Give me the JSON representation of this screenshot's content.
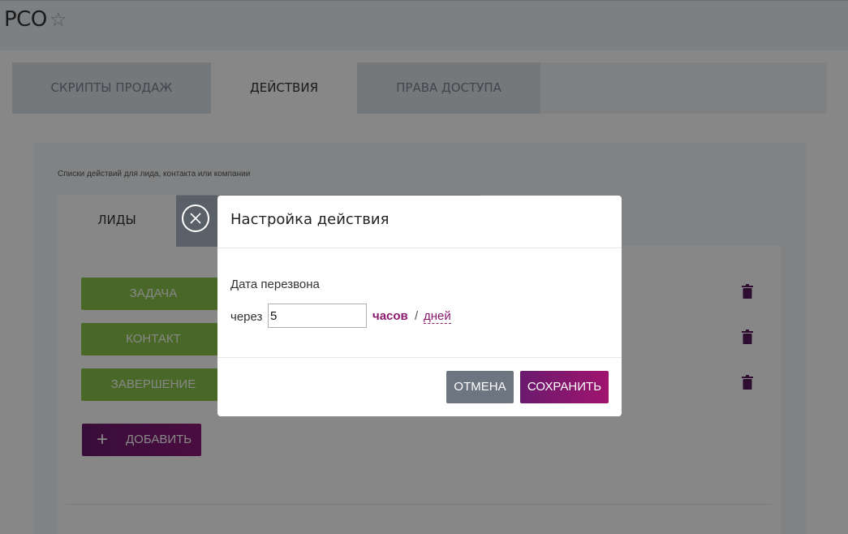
{
  "app": {
    "title": "РСО",
    "favorite_icon": "star-outline-icon"
  },
  "tabs": [
    {
      "label": "СКРИПТЫ ПРОДАЖ",
      "active": false
    },
    {
      "label": "ДЕЙСТВИЯ",
      "active": true
    },
    {
      "label": "ПРАВА ДОСТУПА",
      "active": false
    }
  ],
  "card": {
    "caption": "Списки действий для лида, контакта или компании",
    "subtabs": [
      {
        "label": "ЛИДЫ",
        "active": true
      }
    ],
    "actions": [
      {
        "label": "ЗАДАЧА",
        "delete_icon": "trash-icon"
      },
      {
        "label": "КОНТАКТ",
        "delete_icon": "trash-icon"
      },
      {
        "label": "ЗАВЕРШЕНИЕ",
        "delete_icon": "trash-icon"
      }
    ],
    "add_button": {
      "label": "ДОБАВИТЬ",
      "icon": "plus-icon"
    }
  },
  "modal": {
    "title": "Настройка действия",
    "close_icon": "close-circle-icon",
    "field_label": "Дата перезвона",
    "via_label": "через",
    "amount_value": "5",
    "unit_hours": "часов",
    "unit_separator": "/",
    "unit_days": "дней",
    "cancel_label": "ОТМЕНА",
    "save_label": "СОХРАНИТЬ"
  },
  "colors": {
    "accent": "#8b1a6e",
    "action_green": "#8bc34a",
    "overlay": "rgba(0,0,0,0.47)"
  }
}
